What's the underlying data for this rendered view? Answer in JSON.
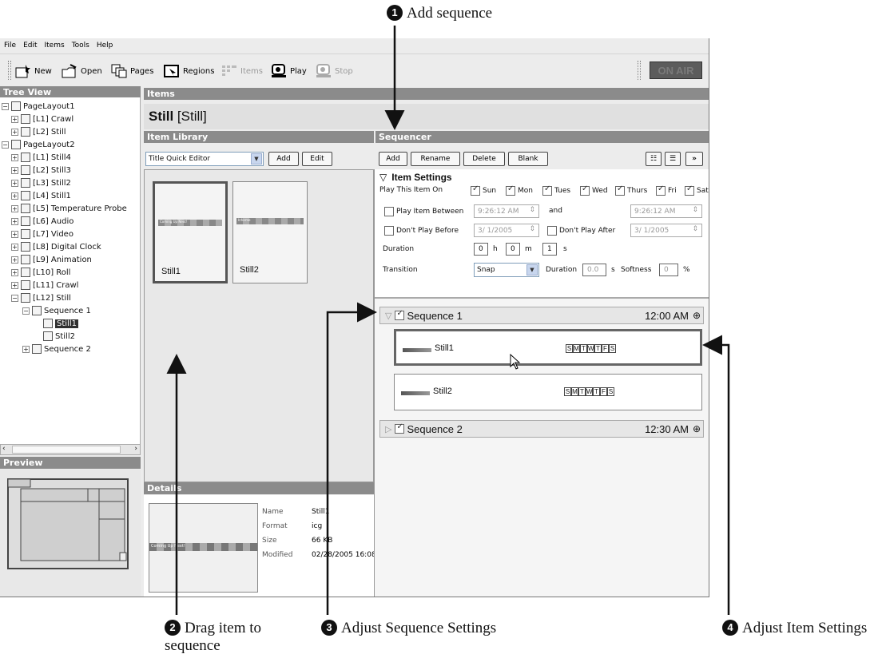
{
  "callouts": [
    {
      "num": "1",
      "text": "Add sequence"
    },
    {
      "num": "2",
      "text": "Drag item to sequence"
    },
    {
      "num": "3",
      "text": "Adjust Sequence Settings"
    },
    {
      "num": "4",
      "text": "Adjust Item Settings"
    }
  ],
  "menu": [
    "File",
    "Edit",
    "Items",
    "Tools",
    "Help"
  ],
  "toolbar": {
    "new": "New",
    "open": "Open",
    "pages": "Pages",
    "regions": "Regions",
    "items": "Items",
    "play": "Play",
    "stop": "Stop",
    "on_air": "ON AIR"
  },
  "tree_view": {
    "title": "Tree View",
    "nodes": [
      "PageLayout1",
      "[L1] Crawl",
      "[L2] Still",
      "PageLayout2",
      "[L1] Still4",
      "[L2] Still3",
      "[L3] Still2",
      "[L4] Still1",
      "[L5] Temperature Probe",
      "[L6] Audio",
      "[L7] Video",
      "[L8] Digital Clock",
      "[L9] Animation",
      "[L10] Roll",
      "[L11] Crawl",
      "[L12] Still",
      "Sequence 1",
      "Still1",
      "Still2",
      "Sequence 2"
    ]
  },
  "preview": {
    "title": "Preview"
  },
  "items": {
    "title": "Items",
    "item_name": "Still",
    "item_type": "[Still]"
  },
  "item_library": {
    "title": "Item Library",
    "editor": "Title Quick Editor",
    "add": "Add",
    "edit": "Edit",
    "thumbs": [
      "Still1",
      "Still2"
    ],
    "thumb_captions": [
      "Coming Up Next!",
      "Informe"
    ]
  },
  "details": {
    "title": "Details",
    "name_label": "Name",
    "name": "Still1",
    "format_label": "Format",
    "format": "icg",
    "size_label": "Size",
    "size": "66 KB",
    "modified_label": "Modified",
    "modified": "02/28/2005 16:08",
    "caption": "Coming Up Next!"
  },
  "sequencer": {
    "title": "Sequencer",
    "buttons": [
      "Add",
      "Rename",
      "Delete",
      "Blank"
    ],
    "settings": {
      "title": "Item Settings",
      "play_on_label": "Play This Item On",
      "days": [
        {
          "label": "Sun",
          "checked": true
        },
        {
          "label": "Mon",
          "checked": true
        },
        {
          "label": "Tues",
          "checked": true
        },
        {
          "label": "Wed",
          "checked": true
        },
        {
          "label": "Thurs",
          "checked": true
        },
        {
          "label": "Fri",
          "checked": true
        },
        {
          "label": "Sat",
          "checked": true
        }
      ],
      "play_between": "Play Item Between",
      "time_from": "9:26:12 AM",
      "and": "and",
      "time_to": "9:26:12 AM",
      "dont_before": "Don't Play Before",
      "date_from": "3/ 1/2005",
      "dont_after": "Don't Play After",
      "date_to": "3/ 1/2005",
      "duration_label": "Duration",
      "hours": "0",
      "h": "h",
      "minutes": "0",
      "m": "m",
      "seconds": "1",
      "s": "s",
      "transition_label": "Transition",
      "transition": "Snap",
      "t_duration_label": "Duration",
      "t_duration": "0.0",
      "t_s": "s",
      "softness_label": "Softness",
      "softness": "0",
      "pct": "%"
    },
    "sequences": [
      {
        "name": "Sequence 1",
        "time": "12:00 AM",
        "expanded": true,
        "items": [
          {
            "name": "Still1",
            "selected": true
          },
          {
            "name": "Still2",
            "selected": false
          }
        ]
      },
      {
        "name": "Sequence 2",
        "time": "12:30 AM",
        "expanded": false,
        "items": []
      }
    ],
    "day_letters": [
      "S",
      "M",
      "T",
      "W",
      "T",
      "F",
      "S"
    ]
  }
}
